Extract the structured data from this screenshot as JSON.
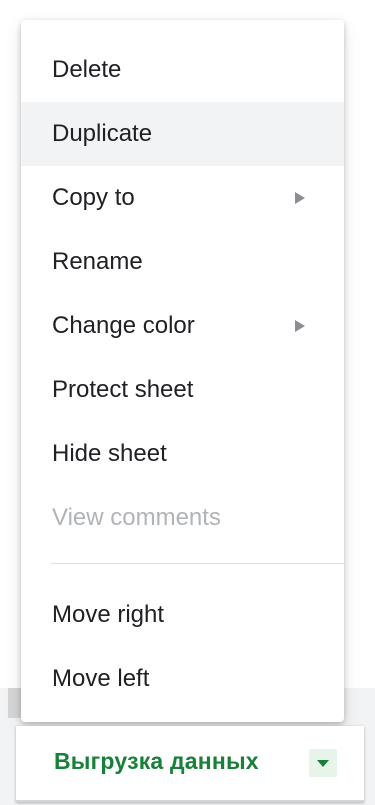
{
  "context_menu": {
    "items": [
      {
        "label": "Delete",
        "disabled": false,
        "has_submenu": false
      },
      {
        "label": "Duplicate",
        "disabled": false,
        "has_submenu": false,
        "highlighted": true
      },
      {
        "label": "Copy to",
        "disabled": false,
        "has_submenu": true
      },
      {
        "label": "Rename",
        "disabled": false,
        "has_submenu": false
      },
      {
        "label": "Change color",
        "disabled": false,
        "has_submenu": true
      },
      {
        "label": "Protect sheet",
        "disabled": false,
        "has_submenu": false
      },
      {
        "label": "Hide sheet",
        "disabled": false,
        "has_submenu": false
      },
      {
        "label": "View comments",
        "disabled": true,
        "has_submenu": false
      },
      {
        "label": "Move right",
        "disabled": false,
        "has_submenu": false
      },
      {
        "label": "Move left",
        "disabled": false,
        "has_submenu": false
      }
    ]
  },
  "sheet_tab": {
    "label": "Выгрузка данных",
    "dropdown_icon": "caret-down-icon"
  },
  "colors": {
    "menu_text": "#202124",
    "disabled_text": "#b1b4b7",
    "hover_bg": "#f1f3f4",
    "tab_accent": "#188038"
  }
}
